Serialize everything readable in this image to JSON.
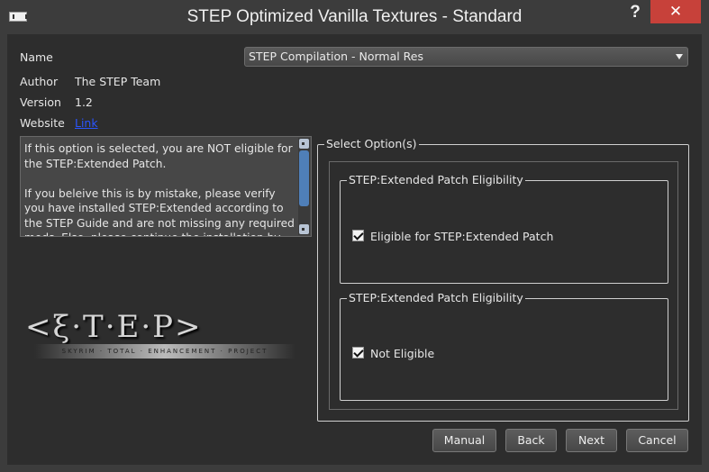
{
  "window": {
    "title": "STEP Optimized Vanilla Textures - Standard",
    "help_label": "?",
    "close_label": "✕",
    "close_color": "#c7413a"
  },
  "info": {
    "name_label": "Name",
    "author_label": "Author",
    "author_value": "The STEP Team",
    "version_label": "Version",
    "version_value": "1.2",
    "website_label": "Website",
    "website_link": "Link"
  },
  "combo": {
    "selected": "STEP Compilation - Normal Res"
  },
  "description": {
    "text": "If this option is selected, you are NOT eligible for the STEP:Extended Patch.\n\nIf you beleive this is by mistake, please verify you have installed STEP:Extended according to the STEP Guide and are not missing any required mods. Else, please continue the installation by clicking the \"Next\""
  },
  "logo": {
    "glyphs": "<ξ·Τ·Ε·Ρ>",
    "subtitle": "SKYRIM · TOTAL · ENHANCEMENT · PROJECT"
  },
  "options": {
    "title": "Select Option(s)",
    "groups": [
      {
        "title": "STEP:Extended Patch Eligibility",
        "checkbox_label": "Eligible for STEP:Extended Patch",
        "checked": true
      },
      {
        "title": "STEP:Extended Patch Eligibility",
        "checkbox_label": "Not Eligible",
        "checked": true
      }
    ]
  },
  "buttons": {
    "manual": "Manual",
    "back": "Back",
    "next": "Next",
    "cancel": "Cancel"
  },
  "colors": {
    "background": "#2d2d2d",
    "title_bg": "#3c3c3c",
    "link": "#2a55ff",
    "scroll_thumb": "#4f7fb8"
  }
}
